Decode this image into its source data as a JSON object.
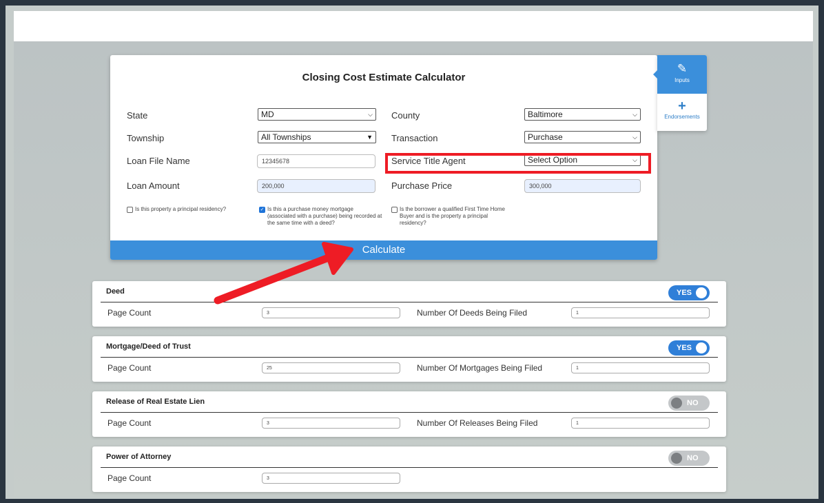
{
  "calculator": {
    "title": "Closing Cost Estimate Calculator",
    "state": {
      "label": "State",
      "value": "MD"
    },
    "county": {
      "label": "County",
      "value": "Baltimore"
    },
    "township": {
      "label": "Township",
      "value": "All Townships"
    },
    "transaction": {
      "label": "Transaction",
      "value": "Purchase"
    },
    "loan_file": {
      "label": "Loan File Name",
      "value": "12345678"
    },
    "service_agent": {
      "label": "Service Title Agent",
      "value": "Select Option"
    },
    "loan_amount": {
      "label": "Loan Amount",
      "value": "200,000"
    },
    "purchase_price": {
      "label": "Purchase Price",
      "value": "300,000"
    },
    "check_residency": {
      "label": "Is this property a principal residency?",
      "checked": false
    },
    "check_purchase_money": {
      "label": "Is this a purchase money mortgage (associated with a purchase) being recorded at the same time with a deed?",
      "checked": true
    },
    "check_first_time": {
      "label": "Is the borrower a qualified First Time Home Buyer and is the property a principal residency?",
      "checked": false
    },
    "calculate_label": "Calculate"
  },
  "side_tabs": {
    "inputs": "Inputs",
    "endorsements": "Endorsements"
  },
  "sections": {
    "deed": {
      "title": "Deed",
      "toggle": "YES",
      "page_count_label": "Page Count",
      "page_count": "3",
      "extra_label": "Number Of Deeds Being Filed",
      "extra_value": "1"
    },
    "mortgage": {
      "title": "Mortgage/Deed of Trust",
      "toggle": "YES",
      "page_count_label": "Page Count",
      "page_count": "25",
      "extra_label": "Number Of Mortgages Being Filed",
      "extra_value": "1"
    },
    "release": {
      "title": "Release of Real Estate Lien",
      "toggle": "NO",
      "page_count_label": "Page Count",
      "page_count": "3",
      "extra_label": "Number Of Releases Being Filed",
      "extra_value": "1"
    },
    "poa": {
      "title": "Power of Attorney",
      "toggle": "NO",
      "page_count_label": "Page Count",
      "page_count": "3"
    }
  },
  "colors": {
    "accent": "#3b8fdb",
    "highlight": "#ee1c25",
    "toggle_on": "#2f7fd8",
    "toggle_off": "#c4c7c9"
  },
  "icons": {
    "inputs": "edit-icon",
    "endorsements": "plus-icon",
    "dropdown": "chevron-down-icon"
  }
}
